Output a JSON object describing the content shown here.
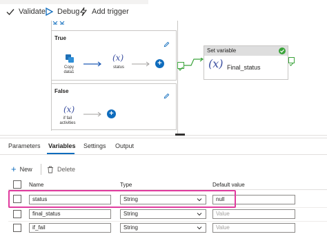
{
  "toolbar": {
    "validate_label": "Validate",
    "debug_label": "Debug",
    "add_trigger_label": "Add trigger"
  },
  "canvas": {
    "true_branch": {
      "title": "True",
      "copy_activity_label_line1": "Copy",
      "copy_activity_label_line2": "data1",
      "set_var_activity_label": "status"
    },
    "false_branch": {
      "title": "False",
      "activity_label_line1": "if fail",
      "activity_label_line2": "activities"
    },
    "set_variable_card": {
      "header": "Set variable",
      "name": "Final_status"
    },
    "variable_glyph": "(x)"
  },
  "panel": {
    "tabs": [
      {
        "label": "Parameters",
        "active": false
      },
      {
        "label": "Variables",
        "active": true
      },
      {
        "label": "Settings",
        "active": false
      },
      {
        "label": "Output",
        "active": false
      }
    ],
    "commands": {
      "new_label": "New",
      "delete_label": "Delete"
    },
    "table": {
      "headers": [
        "Name",
        "Type",
        "Default value"
      ],
      "rows": [
        {
          "name": "status",
          "type": "String",
          "default_value": "null",
          "default_placeholder": "Value"
        },
        {
          "name": "final_status",
          "type": "String",
          "default_value": "",
          "default_placeholder": "Value"
        },
        {
          "name": "if_fail",
          "type": "String",
          "default_value": "",
          "default_placeholder": "Value"
        }
      ]
    }
  },
  "colors": {
    "accent": "#0f6cbd",
    "highlight": "#e03a9e",
    "success": "#3aa33a",
    "variable_icon": "#3b4fa0"
  }
}
